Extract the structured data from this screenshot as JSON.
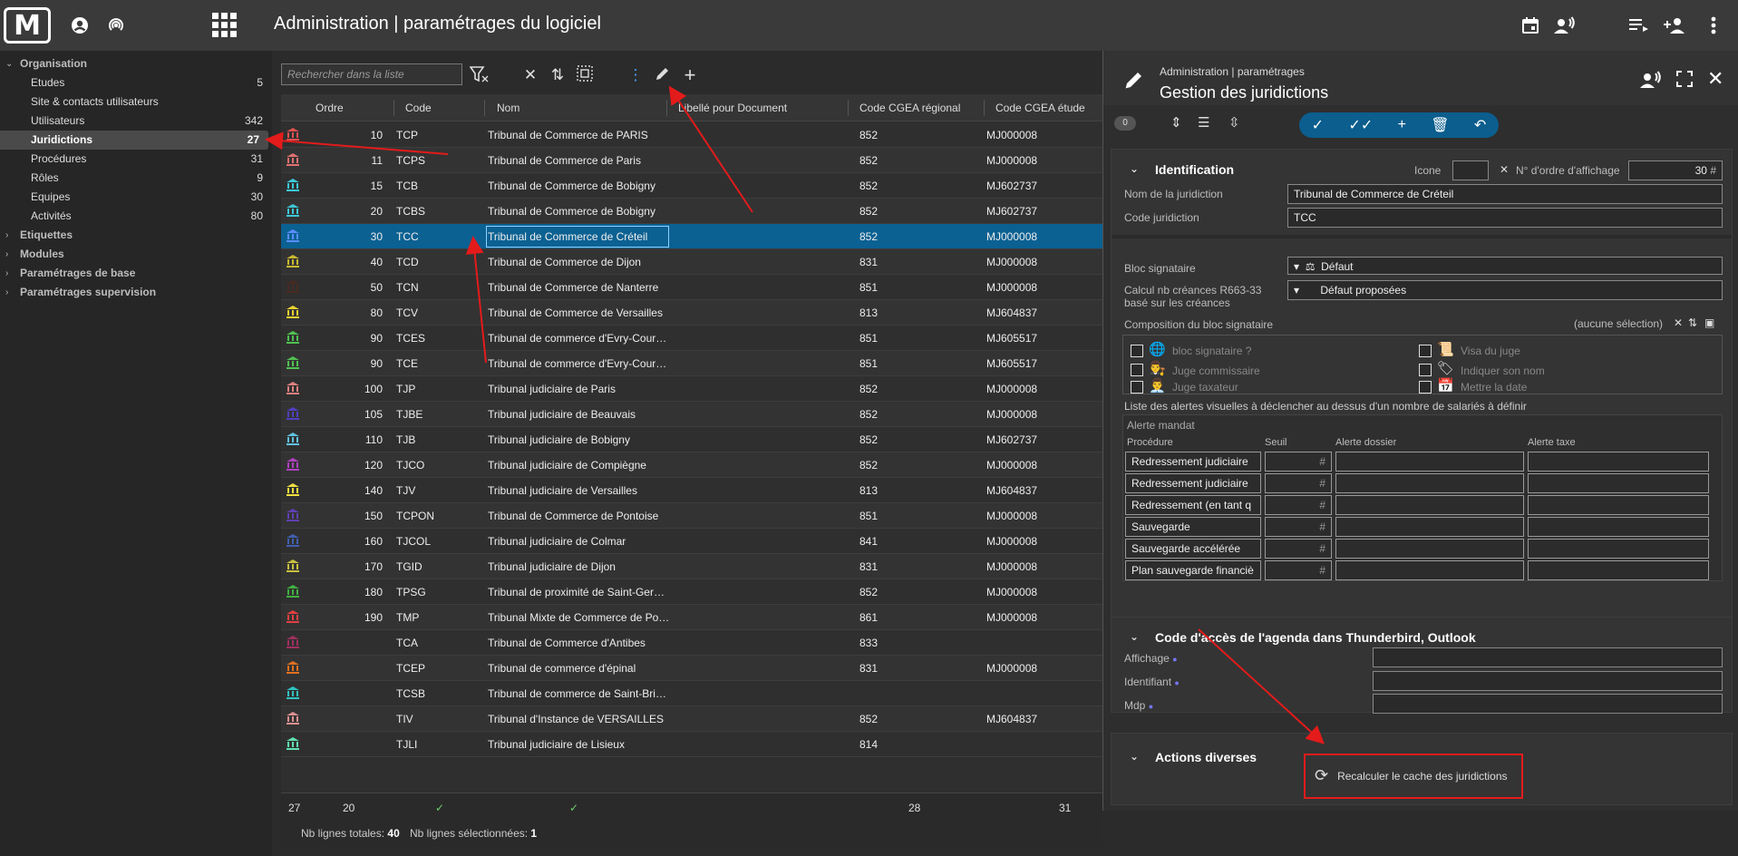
{
  "header": {
    "app_title": "Administration | paramétrages du logiciel",
    "logo_text": "M"
  },
  "sidebar": {
    "groups": [
      {
        "label": "Organisation",
        "expanded": true
      },
      {
        "label": "Etiquettes"
      },
      {
        "label": "Modules"
      },
      {
        "label": "Paramétrages de base"
      },
      {
        "label": "Paramétrages supervision"
      }
    ],
    "items": [
      {
        "label": "Etudes",
        "count": "5"
      },
      {
        "label": "Site & contacts utilisateurs",
        "count": ""
      },
      {
        "label": "Utilisateurs",
        "count": "342"
      },
      {
        "label": "Juridictions",
        "count": "27",
        "active": true
      },
      {
        "label": "Procédures",
        "count": "31"
      },
      {
        "label": "Rôles",
        "count": "9"
      },
      {
        "label": "Equipes",
        "count": "30"
      },
      {
        "label": "Activités",
        "count": "80"
      }
    ]
  },
  "grid": {
    "search_placeholder": "Rechercher dans la liste",
    "columns": [
      "Ordre",
      "Code",
      "Nom",
      "Libellé pour Document",
      "Code CGEA régional",
      "Code CGEA étude"
    ],
    "rows": [
      {
        "ordre": "10",
        "code": "TCP",
        "nom": "Tribunal de Commerce de PARIS",
        "cgea": "852",
        "etude": "MJ000008",
        "color": "#e05050"
      },
      {
        "ordre": "11",
        "code": "TCPS",
        "nom": "Tribunal de Commerce de Paris",
        "cgea": "852",
        "etude": "MJ000008",
        "color": "#e07070"
      },
      {
        "ordre": "15",
        "code": "TCB",
        "nom": "Tribunal de Commerce de Bobigny",
        "cgea": "852",
        "etude": "MJ602737",
        "color": "#3cc8d8"
      },
      {
        "ordre": "20",
        "code": "TCBS",
        "nom": "Tribunal de Commerce de Bobigny",
        "cgea": "852",
        "etude": "MJ602737",
        "color": "#3cc8d8"
      },
      {
        "ordre": "30",
        "code": "TCC",
        "nom": "Tribunal de Commerce de Créteil",
        "cgea": "852",
        "etude": "MJ000008",
        "color": "#5a8cff",
        "selected": true
      },
      {
        "ordre": "40",
        "code": "TCD",
        "nom": "Tribunal de Commerce de Dijon",
        "cgea": "831",
        "etude": "MJ000008",
        "color": "#c8b830"
      },
      {
        "ordre": "50",
        "code": "TCN",
        "nom": "Tribunal de Commerce de Nanterre",
        "cgea": "851",
        "etude": "MJ000008",
        "color": "#4a2a20"
      },
      {
        "ordre": "80",
        "code": "TCV",
        "nom": "Tribunal de Commerce de Versailles",
        "cgea": "813",
        "etude": "MJ604837",
        "color": "#e8d030"
      },
      {
        "ordre": "90",
        "code": "TCES",
        "nom": "Tribunal de commerce d'Evry-Cour…",
        "cgea": "851",
        "etude": "MJ605517",
        "color": "#50c050"
      },
      {
        "ordre": "90",
        "code": "TCE",
        "nom": "Tribunal de commerce d'Evry-Cour…",
        "cgea": "851",
        "etude": "MJ605517",
        "color": "#50c050"
      },
      {
        "ordre": "100",
        "code": "TJP",
        "nom": "Tribunal judiciaire de Paris",
        "cgea": "852",
        "etude": "MJ000008",
        "color": "#e08080"
      },
      {
        "ordre": "105",
        "code": "TJBE",
        "nom": "Tribunal judiciaire de Beauvais",
        "cgea": "852",
        "etude": "MJ000008",
        "color": "#5040c0"
      },
      {
        "ordre": "110",
        "code": "TJB",
        "nom": "Tribunal judiciaire de Bobigny",
        "cgea": "852",
        "etude": "MJ602737",
        "color": "#60c0e0"
      },
      {
        "ordre": "120",
        "code": "TJCO",
        "nom": "Tribunal judiciaire de Compiègne",
        "cgea": "852",
        "etude": "MJ000008",
        "color": "#b040c0"
      },
      {
        "ordre": "140",
        "code": "TJV",
        "nom": "Tribunal judiciaire de Versailles",
        "cgea": "813",
        "etude": "MJ604837",
        "color": "#f0e040"
      },
      {
        "ordre": "150",
        "code": "TCPON",
        "nom": "Tribunal de Commerce de Pontoise",
        "cgea": "851",
        "etude": "MJ000008",
        "color": "#6040b0"
      },
      {
        "ordre": "160",
        "code": "TJCOL",
        "nom": "Tribunal judiciaire de Colmar",
        "cgea": "841",
        "etude": "MJ000008",
        "color": "#4060b0"
      },
      {
        "ordre": "170",
        "code": "TGID",
        "nom": "Tribunal judiciaire de Dijon",
        "cgea": "831",
        "etude": "MJ000008",
        "color": "#c8c040"
      },
      {
        "ordre": "180",
        "code": "TPSG",
        "nom": "Tribunal de proximité de Saint-Ger…",
        "cgea": "852",
        "etude": "MJ000008",
        "color": "#40b040"
      },
      {
        "ordre": "190",
        "code": "TMP",
        "nom": "Tribunal Mixte de Commerce de Po…",
        "cgea": "861",
        "etude": "MJ000008",
        "color": "#e04040"
      },
      {
        "ordre": "",
        "code": "TCA",
        "nom": "Tribunal de Commerce d'Antibes",
        "cgea": "833",
        "etude": "",
        "color": "#a03060"
      },
      {
        "ordre": "",
        "code": "TCEP",
        "nom": "Tribunal de commerce d'épinal",
        "cgea": "831",
        "etude": "MJ000008",
        "color": "#e07020"
      },
      {
        "ordre": "",
        "code": "TCSB",
        "nom": "Tribunal de commerce de Saint-Bri…",
        "cgea": "",
        "etude": "",
        "color": "#30c0c0"
      },
      {
        "ordre": "",
        "code": "TIV",
        "nom": "Tribunal d'Instance de VERSAILLES",
        "cgea": "852",
        "etude": "MJ604837",
        "color": "#e09090"
      },
      {
        "ordre": "",
        "code": "TJLI",
        "nom": "Tribunal judiciaire de Lisieux",
        "cgea": "814",
        "etude": "",
        "color": "#60e0b0"
      }
    ],
    "footer": {
      "count": "27",
      "ordre": "20",
      "cgea": "28",
      "etude": "31"
    },
    "status": {
      "total_label": "Nb lignes totales:",
      "total": "40",
      "selected_label": "Nb lignes sélectionnées:",
      "selected": "1"
    }
  },
  "panel": {
    "subtitle": "Administration | paramétrages",
    "title": "Gestion des juridictions",
    "badge": "0",
    "identification": {
      "title": "Identification",
      "icone_label": "Icone",
      "ordre_label": "N° d'ordre d'affichage",
      "ordre_value": "30",
      "ordre_suffix": "#",
      "nom_label": "Nom de la juridiction",
      "nom_value": "Tribunal de Commerce de Créteil",
      "code_label": "Code juridiction",
      "code_value": "TCC"
    },
    "bloc": {
      "signataire_label": "Bloc signataire",
      "signataire_value": "Défaut",
      "calcul_label_1": "Calcul nb créances R663-33",
      "calcul_label_2": "basé sur les créances",
      "calcul_value": "Défaut proposées",
      "composition_label": "Composition du bloc signataire",
      "composition_value": "(aucune sélection)",
      "options": [
        "bloc signataire ?",
        "Visa du juge",
        "Juge commissaire",
        "Indiquer son nom",
        "Juge taxateur",
        "Mettre la date"
      ]
    },
    "alertes": {
      "title": "Liste des alertes visuelles à déclencher au dessus d'un nombre de salariés à définir",
      "subtitle": "Alerte mandat",
      "columns": [
        "Procédure",
        "Seuil",
        "Alerte dossier",
        "Alerte taxe"
      ],
      "rows": [
        "Redressement judiciaire",
        "Redressement judiciaire",
        "Redressement (en tant q",
        "Sauvegarde",
        "Sauvegarde accélérée",
        "Plan sauvegarde financiè"
      ],
      "hash": "#"
    },
    "agenda": {
      "title": "Code d'accès de l'agenda dans Thunderbird, Outlook",
      "fields": [
        "Affichage",
        "Identifiant",
        "Mdp"
      ]
    },
    "actions": {
      "title": "Actions diverses",
      "recalc_label": "Recalculer le cache des juridictions"
    }
  }
}
